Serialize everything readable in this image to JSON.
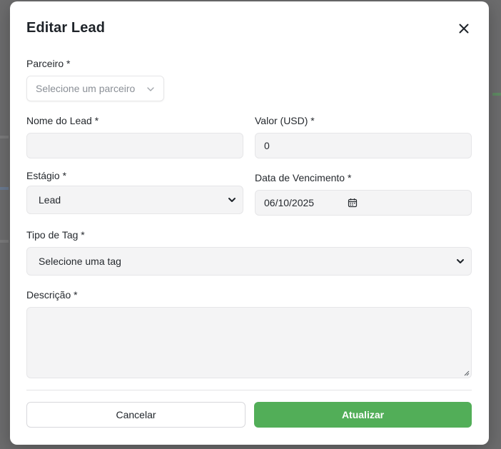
{
  "modal": {
    "title": "Editar Lead",
    "close_icon": "close-icon"
  },
  "fields": {
    "partner": {
      "label": "Parceiro *",
      "placeholder": "Selecione um parceiro",
      "icon": "chevron-down-icon"
    },
    "lead_name": {
      "label": "Nome do Lead *",
      "value": ""
    },
    "value_usd": {
      "label": "Valor (USD) *",
      "value": "0"
    },
    "stage": {
      "label": "Estágio *",
      "selected": "Lead"
    },
    "due_date": {
      "label": "Data de Vencimento *",
      "value": "06/10/2025",
      "icon": "calendar-icon"
    },
    "tag_type": {
      "label": "Tipo de Tag *",
      "selected": "Selecione uma tag"
    },
    "description": {
      "label": "Descrição *",
      "value": ""
    }
  },
  "actions": {
    "cancel_label": "Cancelar",
    "update_label": "Atualizar"
  },
  "colors": {
    "primary_button": "#52ae58",
    "field_background": "#f4f4f5",
    "overlay": "#6f6f70"
  }
}
